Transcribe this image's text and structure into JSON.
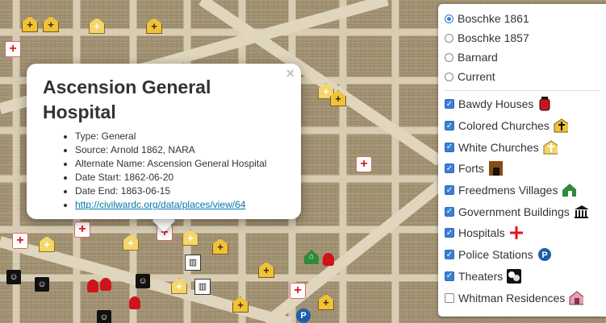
{
  "popup": {
    "close_label": "×",
    "title": "Ascension General Hospital",
    "items": [
      "Type: General",
      "Source: Arnold 1862, NARA",
      "Alternate Name: Ascension General Hospital",
      "Date Start: 1862-06-20",
      "Date End: 1863-06-15"
    ],
    "link_text": "http://civilwardc.org/data/places/view/64"
  },
  "layers": {
    "base_maps": [
      {
        "label": "Boschke 1861",
        "selected": true
      },
      {
        "label": "Boschke 1857",
        "selected": false
      },
      {
        "label": "Barnard",
        "selected": false
      },
      {
        "label": "Current",
        "selected": false
      }
    ],
    "overlays": [
      {
        "label": "Bawdy Houses",
        "checked": true,
        "icon": "bawdy-house-icon"
      },
      {
        "label": "Colored Churches",
        "checked": true,
        "icon": "colored-church-icon"
      },
      {
        "label": "White Churches",
        "checked": true,
        "icon": "white-church-icon"
      },
      {
        "label": "Forts",
        "checked": true,
        "icon": "fort-icon"
      },
      {
        "label": "Freedmens Villages",
        "checked": true,
        "icon": "freedmens-village-icon"
      },
      {
        "label": "Government Buildings",
        "checked": true,
        "icon": "government-building-icon"
      },
      {
        "label": "Hospitals",
        "checked": true,
        "icon": "hospital-icon"
      },
      {
        "label": "Police Stations",
        "checked": true,
        "icon": "police-station-icon"
      },
      {
        "label": "Theaters",
        "checked": true,
        "icon": "theater-icon"
      },
      {
        "label": "Whitman Residences",
        "checked": false,
        "icon": "whitman-residence-icon"
      }
    ]
  },
  "colors": {
    "map_paper": "#b3a489",
    "street": "#d9cfb6",
    "hospital": "#e0161b",
    "church": "#f0c23a",
    "police": "#1c5fa8",
    "freedmens": "#2f8a3a",
    "link": "#0078a8",
    "accent": "#3b7fd6"
  }
}
